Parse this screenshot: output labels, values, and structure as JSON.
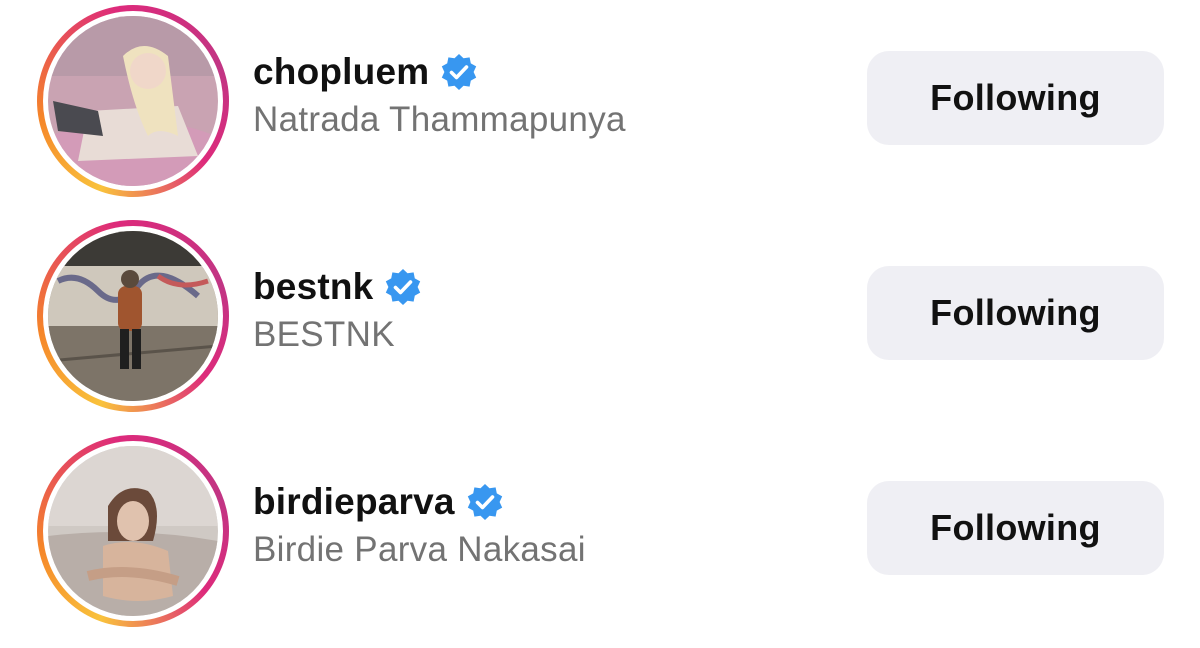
{
  "accounts": [
    {
      "username": "chopluem",
      "full_name": "Natrada Thammapunya",
      "verified": true,
      "button_label": "Following",
      "avatar_icon": "profile-photo"
    },
    {
      "username": "bestnk",
      "full_name": "BESTNK",
      "verified": true,
      "button_label": "Following",
      "avatar_icon": "profile-photo"
    },
    {
      "username": "birdieparva",
      "full_name": "Birdie Parva Nakasai",
      "verified": true,
      "button_label": "Following",
      "avatar_icon": "profile-photo"
    }
  ],
  "colors": {
    "verified_badge": "#3897f0",
    "button_bg": "#efeff4",
    "username_text": "#111111",
    "fullname_text": "#737373"
  }
}
